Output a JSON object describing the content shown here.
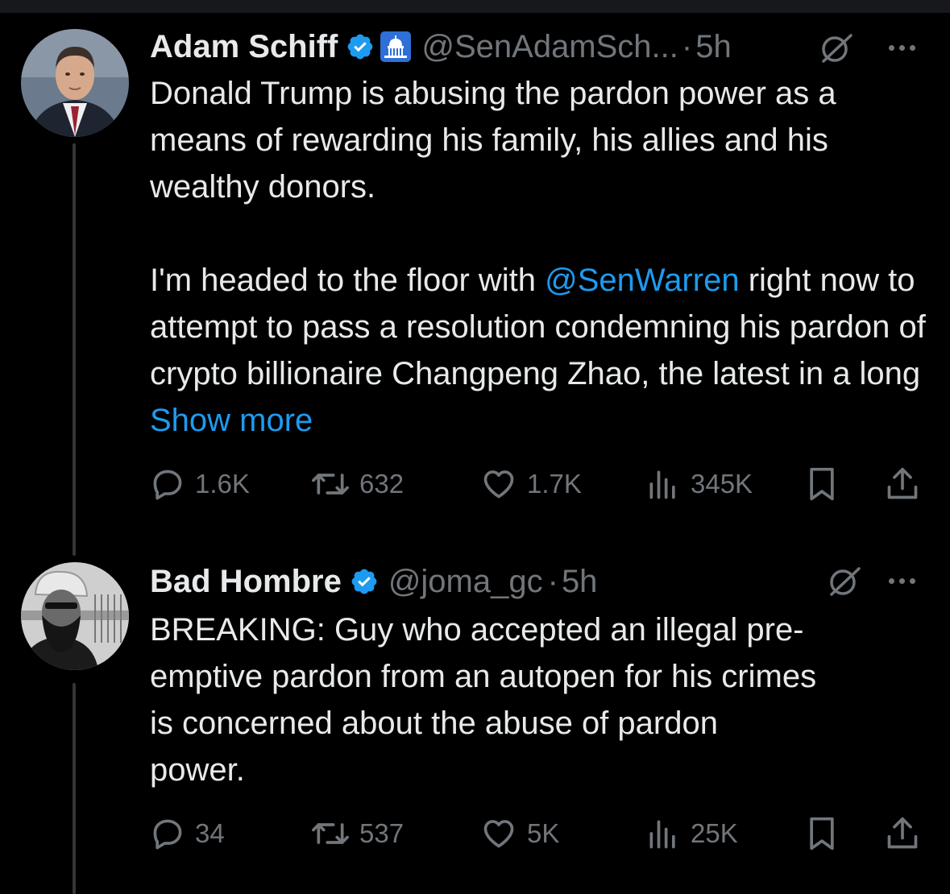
{
  "tweets": [
    {
      "name": "Adam Schiff",
      "handle": "@SenAdamSch...",
      "dot": "·",
      "time": "5h",
      "text_before_mention": "Donald Trump is abusing the pardon power as a means of rewarding his family, his allies and his wealthy donors.\n\nI'm headed to the floor with ",
      "mention": "@SenWarren",
      "text_after_mention": " right now to attempt to pass a resolution condemning his pardon of crypto billionaire Changpeng Zhao, the latest in a long ",
      "show_more": "Show more",
      "replies": "1.6K",
      "reposts": "632",
      "likes": "1.7K",
      "views": "345K",
      "avatar_icon": "avatar-photo-man-suit",
      "badges": [
        "verified-badge-icon",
        "capitol-building-icon"
      ]
    },
    {
      "name": "Bad Hombre",
      "handle": "@joma_gc",
      "dot": "·",
      "time": "5h",
      "text": "BREAKING: Guy who accepted an illegal pre-\nemptive pardon from an autopen for his crimes\nis concerned about the abuse of pardon\npower.",
      "replies": "34",
      "reposts": "537",
      "likes": "5K",
      "views": "25K",
      "avatar_icon": "avatar-photo-man-beard",
      "badges": [
        "verified-badge-icon"
      ]
    }
  ],
  "colors": {
    "background": "#000000",
    "text": "#e7e9ea",
    "muted": "#71767b",
    "link": "#1d9bf0",
    "verified": "#1d9bf0",
    "thread_line": "#333639"
  }
}
